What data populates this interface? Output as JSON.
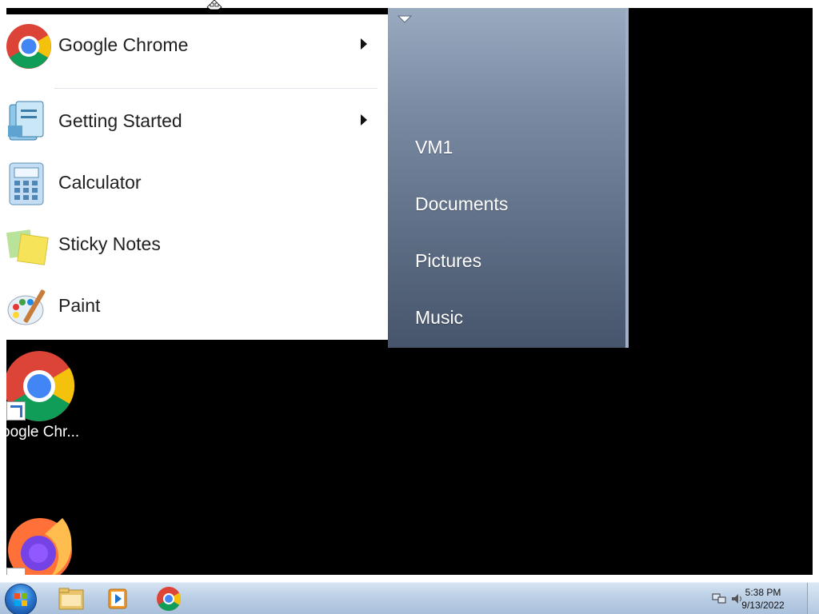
{
  "desktop": {
    "icons": [
      {
        "label": "oogle Chr...",
        "icon": "chrome-icon"
      },
      {
        "label": "",
        "icon": "firefox-icon"
      }
    ]
  },
  "start_menu": {
    "programs": [
      {
        "label": "Google Chrome",
        "icon": "chrome-icon",
        "has_submenu": true
      },
      {
        "label": "Getting Started",
        "icon": "getting-started-icon",
        "has_submenu": true
      },
      {
        "label": "Calculator",
        "icon": "calculator-icon",
        "has_submenu": false
      },
      {
        "label": "Sticky Notes",
        "icon": "sticky-notes-icon",
        "has_submenu": false
      },
      {
        "label": "Paint",
        "icon": "paint-icon",
        "has_submenu": false
      }
    ],
    "places": [
      "VM1",
      "Documents",
      "Pictures",
      "Music"
    ]
  },
  "taskbar": {
    "pinned": [
      "folder-icon",
      "media-player-icon",
      "chrome-icon"
    ],
    "tray": [
      "network-icon",
      "volume-icon"
    ],
    "clock": {
      "time": "5:38 PM",
      "date": "9/13/2022"
    }
  },
  "colors": {
    "desktop_background": "#000000",
    "start_menu_right_pane": "#5b6b82",
    "taskbar": "#b9cde4"
  }
}
